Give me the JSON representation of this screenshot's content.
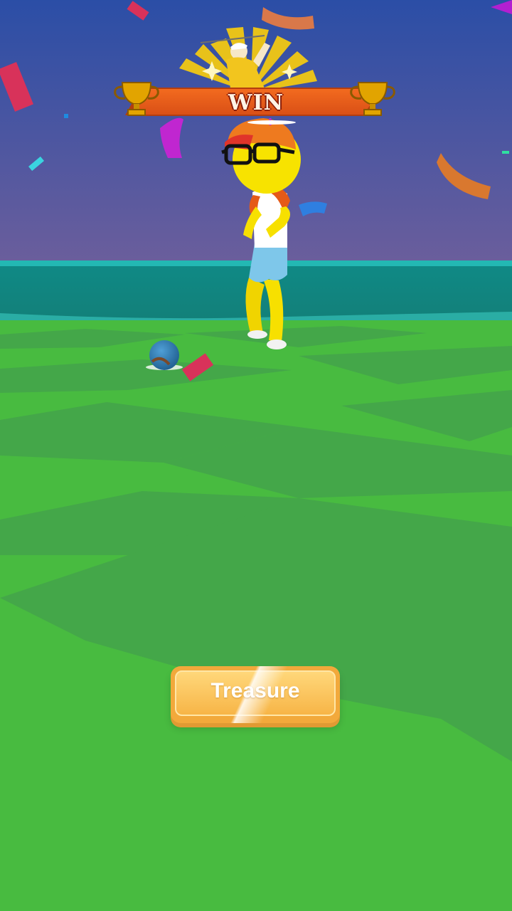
{
  "hud": {
    "result_label": "WIN",
    "treasure_button_label": "Treasure"
  },
  "icons": [
    "trophy-icon",
    "golfer-emblem-icon",
    "golf-ball-icon"
  ],
  "colors": {
    "sky_top": "#2e50a5",
    "sky_bottom": "#6a5f9e",
    "sea": "#11908c",
    "grass_light": "#4bbf3f",
    "grass_dark": "#43a848",
    "banner_ribbon": "#e85d1c",
    "button": "#f7b547"
  }
}
